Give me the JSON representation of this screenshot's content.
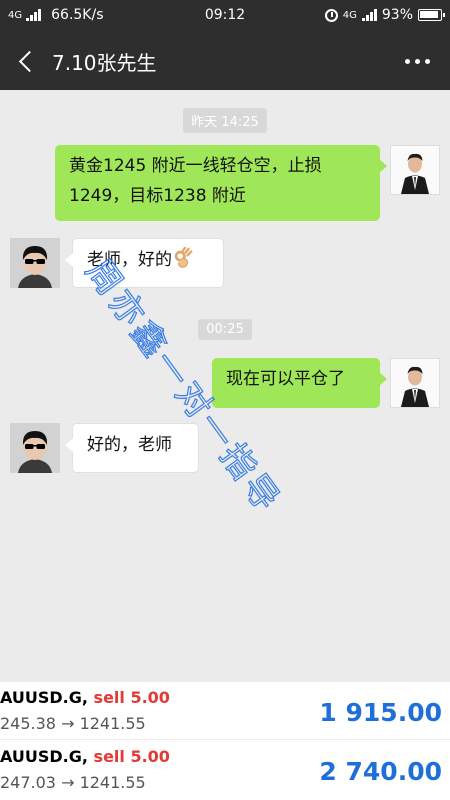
{
  "status_bar": {
    "network": "4G",
    "speed": "66.5K/s",
    "time": "09:12",
    "network_right": "4G",
    "battery": "93%"
  },
  "nav": {
    "title": "7.10张先生"
  },
  "chat": {
    "timestamps": [
      "昨天 14:25",
      "00:25"
    ],
    "messages": [
      {
        "sender": "coach",
        "direction": "out",
        "lines": [
          "黄金1245 附近一线轻仓空，止损",
          "1249，目标1238 附近"
        ]
      },
      {
        "sender": "user",
        "direction": "in",
        "text": "老师，好的",
        "emoji": "ok-hand-icon"
      },
      {
        "sender": "coach",
        "direction": "out",
        "text": "现在可以平仓了"
      },
      {
        "sender": "user",
        "direction": "in",
        "text": "好的，老师"
      }
    ]
  },
  "watermark": "周亦鑫一对一指导",
  "trades": [
    {
      "symbol": "AUUSD.G,",
      "direction": "sell 5.00",
      "prices": "245.38 → 1241.55",
      "profit": "1 915.00"
    },
    {
      "symbol": "AUUSD.G,",
      "direction": "sell 5.00",
      "prices": "247.03 → 1241.55",
      "profit": "2 740.00"
    }
  ],
  "colors": {
    "header": "#2e2e2e",
    "chat_bg": "#ebebeb",
    "bubble_out": "#9fe658",
    "bubble_in": "#ffffff",
    "sell": "#e53935",
    "profit": "#1e6fd9",
    "watermark": "#3b7fe6"
  }
}
